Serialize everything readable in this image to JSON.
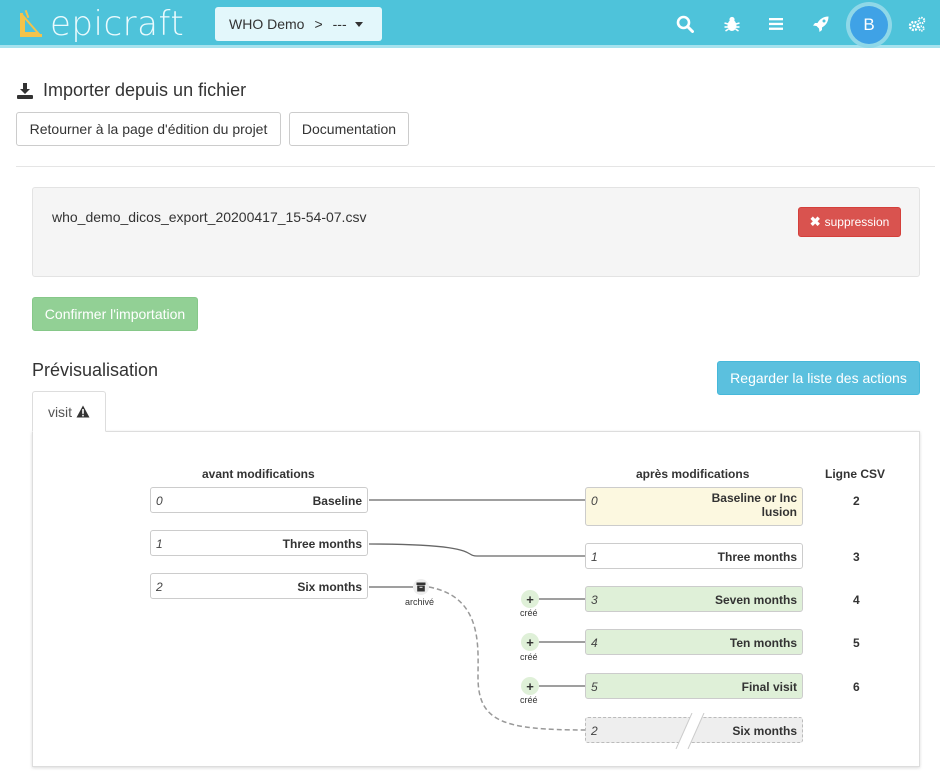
{
  "navbar": {
    "logo_text": "epicraft",
    "project_name": "WHO Demo",
    "project_separator": ">",
    "project_sub": "---",
    "avatar_initial": "B",
    "icons": [
      "search-icon",
      "bug-icon",
      "menu-icon",
      "rocket-icon",
      "cogs-icon"
    ],
    "color": "#4ec3da"
  },
  "page": {
    "title": "Importer depuis un fichier",
    "back_button": "Retourner à la page d'édition du projet",
    "doc_button": "Documentation"
  },
  "file": {
    "name": "who_demo_dicos_export_20200417_15-54-07.csv",
    "delete_button": "suppression",
    "confirm_button": "Confirmer l'importation"
  },
  "preview": {
    "title": "Prévisualisation",
    "actions_button": "Regarder la liste des actions",
    "tab_label": "visit",
    "before_heading": "avant modifications",
    "after_heading": "après modifications",
    "csv_heading": "Ligne CSV",
    "archived_label": "archivé",
    "created_label": "créé",
    "before": [
      {
        "index": "0",
        "label": "Baseline"
      },
      {
        "index": "1",
        "label": "Three months"
      },
      {
        "index": "2",
        "label": "Six months"
      }
    ],
    "after": [
      {
        "index": "0",
        "label": "Baseline or Inc lusion",
        "label_line1": "Baseline or Inc",
        "label_line2": "lusion",
        "csv": "2",
        "state": "modified"
      },
      {
        "index": "1",
        "label": "Three months",
        "csv": "3",
        "state": "unchanged"
      },
      {
        "index": "3",
        "label": "Seven months",
        "csv": "4",
        "state": "created"
      },
      {
        "index": "4",
        "label": "Ten months",
        "csv": "5",
        "state": "created"
      },
      {
        "index": "5",
        "label": "Final visit",
        "csv": "6",
        "state": "created"
      },
      {
        "index": "2",
        "label": "Six months",
        "csv": "",
        "state": "archived"
      }
    ]
  }
}
